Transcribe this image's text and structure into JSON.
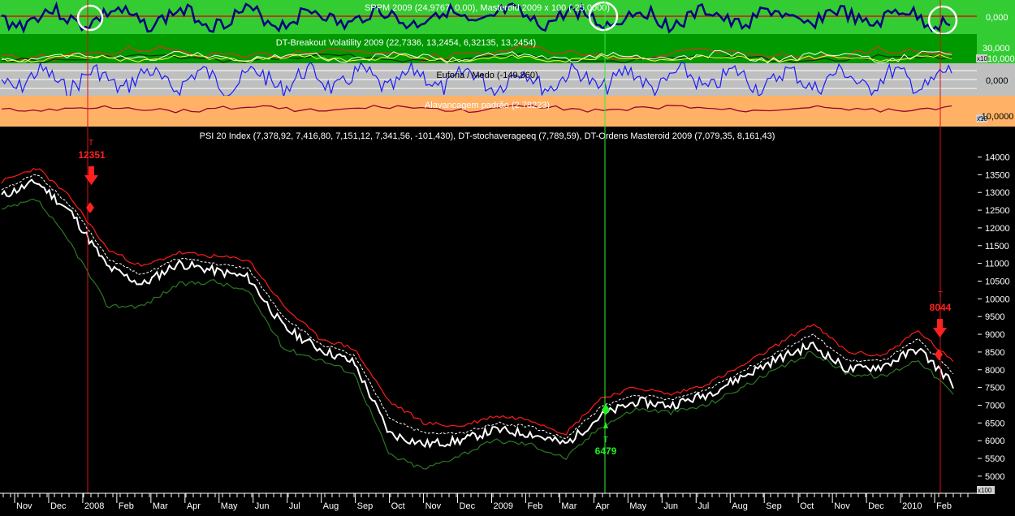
{
  "panels": {
    "sppm": {
      "title": "SPPM 2009 (24,9767, 0,00), Masteroid 2009 x 100 (-25,0000)",
      "tick": "0,000"
    },
    "breakout": {
      "title": "DT-Breakout Volatility 2009 (22,7336, 13,2454, 6,32135, 13,2454)",
      "tick_top": "30,000",
      "tick_bottom": "10,000",
      "scale": "x10"
    },
    "euforia": {
      "title": "Euforia / Medo (-149,860)",
      "tick": "0,000"
    },
    "alavancagem": {
      "title": "Alavancagem padrão (2,78223)",
      "tick": "-10,0000",
      "scale": "x10"
    },
    "price": {
      "title": "PSI 20 Index (7,378,92, 7,416,80, 7,151,12, 7,341,56, -101,430), DT-stochaverageeq (7,789,59), DT-Ordens Masteroid 2009 (7,079,35, 8,161,43)"
    }
  },
  "signals": [
    {
      "label": "12351",
      "marker": "T",
      "color": "#ff2020"
    },
    {
      "label": "6479",
      "marker": "T",
      "color": "#22ee22"
    },
    {
      "label": "8044",
      "marker": "T",
      "color": "#ff2020"
    }
  ],
  "x_scale_label": "x100",
  "colors": {
    "green_bg": "#33cc33",
    "dark_green_bg": "#009900",
    "gray_bg": "#bfbfbf",
    "orange_bg": "#ffb266",
    "price": "#ffffff",
    "upper_band": "#ff1a1a",
    "lower_band": "#2a7a22",
    "sppm_line": "#000080",
    "euforia_line": "#1a1aff",
    "alav_line": "#990033"
  },
  "chart_data": {
    "type": "line",
    "title": "PSI 20 Index",
    "xlabel": "",
    "ylabel": "",
    "categories": [
      "Nov",
      "Dec",
      "2008",
      "Feb",
      "Mar",
      "Apr",
      "May",
      "Jun",
      "Jul",
      "Aug",
      "Sep",
      "Oct",
      "Nov",
      "Dec",
      "2009",
      "Feb",
      "Mar",
      "Apr",
      "May",
      "Jun",
      "Jul",
      "Aug",
      "Sep",
      "Oct",
      "Nov",
      "Dec",
      "2010",
      "Feb"
    ],
    "y_ticks": [
      14000,
      13500,
      13000,
      12500,
      12000,
      11500,
      11000,
      10500,
      10000,
      9500,
      9000,
      8500,
      8000,
      7500,
      7000,
      6500,
      6000,
      5500,
      5000
    ],
    "ylim": [
      4700,
      14400
    ],
    "series": [
      {
        "name": "PSI 20 Index",
        "values": [
          12900,
          13300,
          12400,
          10900,
          10400,
          11000,
          10800,
          10600,
          9200,
          8600,
          8200,
          6200,
          5900,
          6000,
          6300,
          6200,
          5900,
          6700,
          7100,
          7000,
          7300,
          7800,
          8300,
          8700,
          8000,
          8100,
          8600,
          7600
        ]
      },
      {
        "name": "DT-stochaverageeq",
        "values": [
          13300,
          13700,
          12800,
          11400,
          10900,
          11300,
          11200,
          11100,
          9800,
          8900,
          8600,
          7100,
          6500,
          6400,
          6700,
          6600,
          6200,
          7200,
          7500,
          7300,
          7600,
          8100,
          8700,
          9300,
          8500,
          8400,
          9100,
          8200
        ]
      },
      {
        "name": "DT-Ordens Masteroid 2009",
        "values": [
          12500,
          12800,
          11500,
          9800,
          9800,
          10400,
          10500,
          10200,
          8600,
          8300,
          7900,
          5600,
          5200,
          5600,
          6000,
          5900,
          5500,
          6400,
          6900,
          6800,
          7000,
          7500,
          8000,
          8500,
          7900,
          7800,
          8300,
          7300
        ]
      }
    ]
  }
}
